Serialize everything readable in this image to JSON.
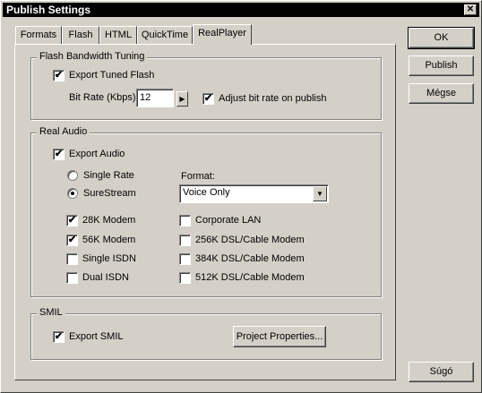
{
  "window": {
    "title": "Publish Settings",
    "close_glyph": "✕"
  },
  "tabs": [
    {
      "label": "Formats"
    },
    {
      "label": "Flash"
    },
    {
      "label": "HTML"
    },
    {
      "label": "QuickTime"
    },
    {
      "label": "RealPlayer"
    }
  ],
  "active_tab": "RealPlayer",
  "flash_tuning": {
    "title": "Flash Bandwidth Tuning",
    "export_tuned": {
      "label": "Export Tuned Flash",
      "checked": true
    },
    "bit_rate_label": "Bit Rate (Kbps):",
    "bit_rate_value": "12",
    "adjust": {
      "label": "Adjust bit rate on publish",
      "checked": true
    }
  },
  "real_audio": {
    "title": "Real Audio",
    "export_audio": {
      "label": "Export Audio",
      "checked": true
    },
    "single_rate": {
      "label": "Single Rate",
      "selected": false
    },
    "surestream": {
      "label": "SureStream",
      "selected": true
    },
    "format_label": "Format:",
    "format_value": "Voice Only",
    "targets": [
      {
        "label": "28K Modem",
        "checked": true
      },
      {
        "label": "56K Modem",
        "checked": true
      },
      {
        "label": "Single ISDN",
        "checked": false
      },
      {
        "label": "Dual ISDN",
        "checked": false
      },
      {
        "label": "Corporate LAN",
        "checked": false
      },
      {
        "label": "256K DSL/Cable Modem",
        "checked": false
      },
      {
        "label": "384K DSL/Cable Modem",
        "checked": false
      },
      {
        "label": "512K DSL/Cable Modem",
        "checked": false
      }
    ]
  },
  "smil": {
    "title": "SMIL",
    "export_smil": {
      "label": "Export SMIL",
      "checked": true
    },
    "project_properties_label": "Project Properties..."
  },
  "buttons": {
    "ok": "OK",
    "publish": "Publish",
    "cancel": "Mégse",
    "help": "Súgó"
  },
  "check_glyph": "✔",
  "arrow_right_glyph": "▶",
  "arrow_down_glyph": "▼"
}
